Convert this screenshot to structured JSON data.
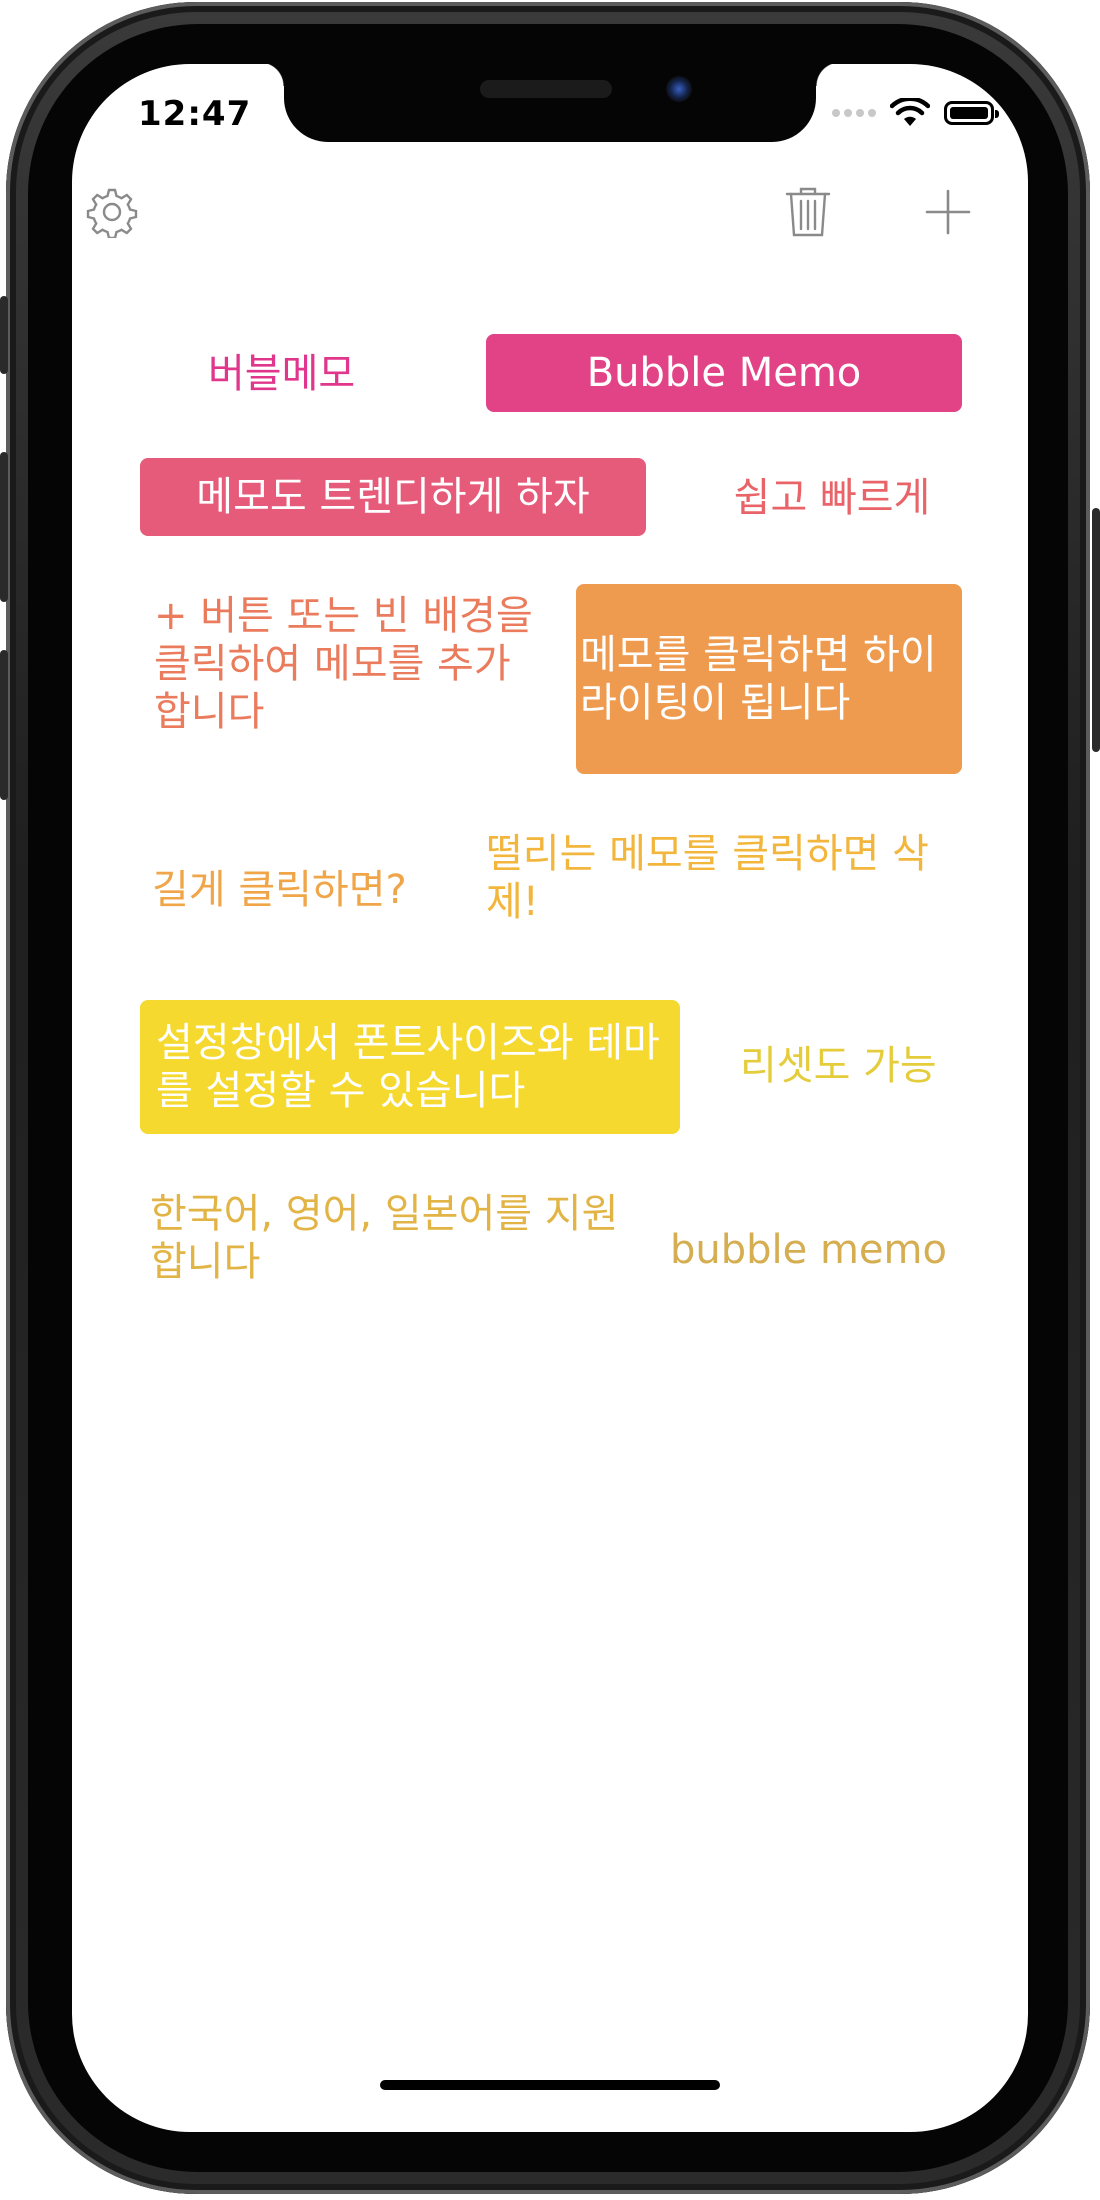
{
  "status_bar": {
    "time": "12:47"
  },
  "toolbar": {
    "settings_icon": "gear-icon",
    "trash_icon": "trash-icon",
    "add_icon": "plus-icon"
  },
  "memos": [
    {
      "text": "버블메모",
      "color": "#E0368C",
      "filled": false
    },
    {
      "text": "Bubble Memo",
      "color": "#E24386",
      "filled": true
    },
    {
      "text": "메모도 트렌디하게 하자",
      "color": "#E65A7A",
      "filled": true
    },
    {
      "text": "쉽고 빠르게",
      "color": "#E86468",
      "filled": false
    },
    {
      "text": "+ 버튼 또는 빈 배경을 클릭하여 메모를 추가합니다",
      "color": "#EA7B5C",
      "filled": false
    },
    {
      "text": "메모를 클릭하면 하이라이팅이 됩니다",
      "color": "#EE9B50",
      "filled": true
    },
    {
      "text": "길게 클릭하면?",
      "color": "#EFA548",
      "filled": false
    },
    {
      "text": "떨리는 메모를 클릭하면 삭제!",
      "color": "#F2B63C",
      "filled": false
    },
    {
      "text": "설정창에서 폰트사이즈와 테마를 설정할 수 있습니다",
      "color": "#F5D92F",
      "filled": true
    },
    {
      "text": "리셋도 가능",
      "color": "#E4CC3A",
      "filled": false
    },
    {
      "text": "한국어, 영어, 일본어를 지원합니다",
      "color": "#E2B445",
      "filled": false
    },
    {
      "text": "bubble memo",
      "color": "#D5AE52",
      "filled": false
    }
  ]
}
